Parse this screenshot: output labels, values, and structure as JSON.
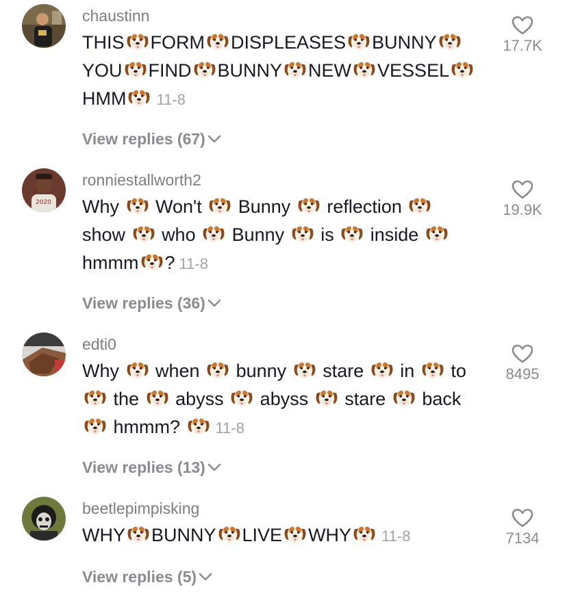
{
  "comments": [
    {
      "username": "chaustinn",
      "text_segments": [
        "THIS",
        "FORM",
        "DISPLEASES",
        "BUNNY",
        "YOU",
        "FIND",
        "BUNNY",
        "NEW",
        "VESSEL",
        "HMM"
      ],
      "date": "11-8",
      "likes": "17.7K",
      "replies_label": "View replies (67)",
      "emoji_icon": "dog-face-icon"
    },
    {
      "username": "ronniestallworth2",
      "text_segments": [
        "Why",
        "Won't",
        "Bunny",
        "reflection",
        "show",
        "who",
        "Bunny",
        "is",
        "inside",
        "hmmm",
        "?"
      ],
      "date": "11-8",
      "likes": "19.9K",
      "replies_label": "View replies (36)",
      "emoji_icon": "dog-face-icon"
    },
    {
      "username": "edti0",
      "text_segments": [
        "Why",
        "when",
        "bunny",
        "stare",
        "in",
        "to",
        "the",
        "abyss",
        "abyss",
        "stare",
        "back",
        "hmmm?"
      ],
      "date": "11-8",
      "likes": "8495",
      "replies_label": "View replies (13)",
      "emoji_icon": "dog-face-icon"
    },
    {
      "username": "beetlepimpisking",
      "text_segments": [
        "WHY",
        "BUNNY",
        "LIVE",
        "WHY"
      ],
      "date": "11-8",
      "likes": "7134",
      "replies_label": "View replies (5)",
      "emoji_icon": "dog-face-icon"
    }
  ],
  "colors": {
    "username": "#7c7c82",
    "text": "#161823",
    "meta": "#a1a2a7",
    "replies": "#8a8b91"
  }
}
